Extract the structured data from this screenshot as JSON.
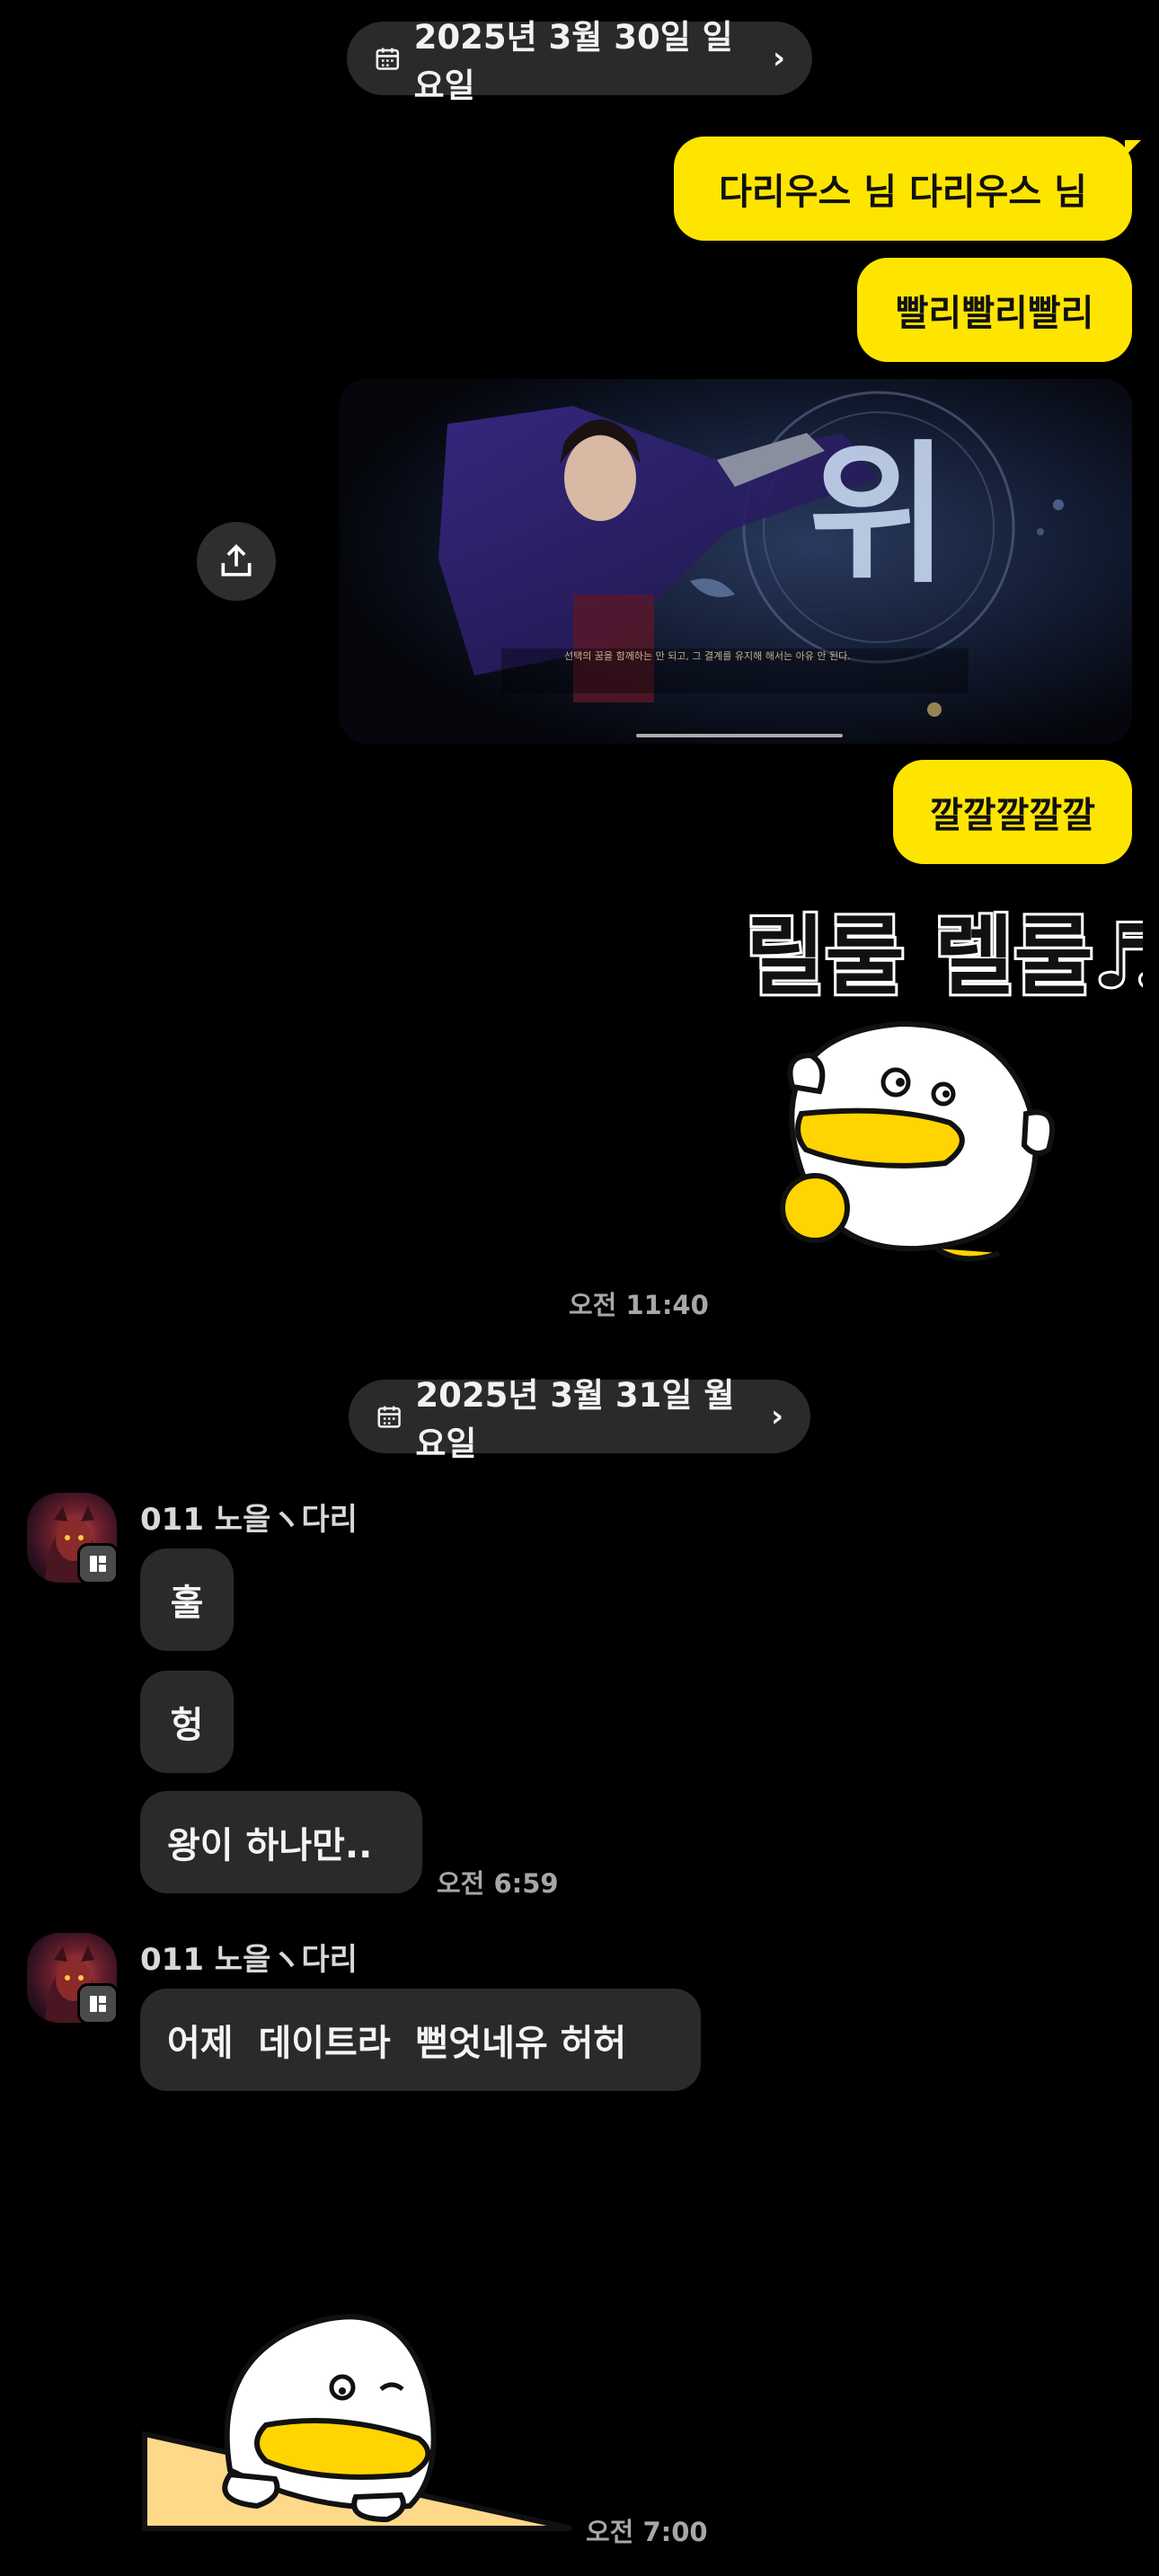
{
  "date_dividers": [
    {
      "label": "2025년 3월 30일 일요일",
      "chevron": "›"
    },
    {
      "label": "2025년 3월 31일 월요일",
      "chevron": "›"
    }
  ],
  "my_messages": [
    {
      "text": "다리우스 님 다리우스 님"
    },
    {
      "text": "빨리빨리빨리"
    },
    {
      "text": "깔깔깔깔깔"
    }
  ],
  "image_message": {
    "big_glyph": "위",
    "caption": "선택의 꿈을 함께하는 만 되고, 그 결계를 유지해 해서는 아유 안 된다.",
    "share_icon": "share-upload-icon"
  },
  "sticker_1": {
    "text": "릴룰 렐룰♬"
  },
  "time_1": "오전 11:40",
  "sender_groups": [
    {
      "name": "011 노을ヽ다리",
      "messages": [
        "훌",
        "헝",
        "왕이 하나만.."
      ],
      "time": "오전 6:59"
    },
    {
      "name": "011 노을ヽ다리",
      "messages": [
        "어제  데이트라  뻗엇네유 허허"
      ]
    }
  ],
  "time_3": "오전 7:00",
  "colors": {
    "background": "#000000",
    "my_bubble": "#fee500",
    "their_bubble": "#2a2a2a",
    "pill": "#2a2a2a"
  }
}
